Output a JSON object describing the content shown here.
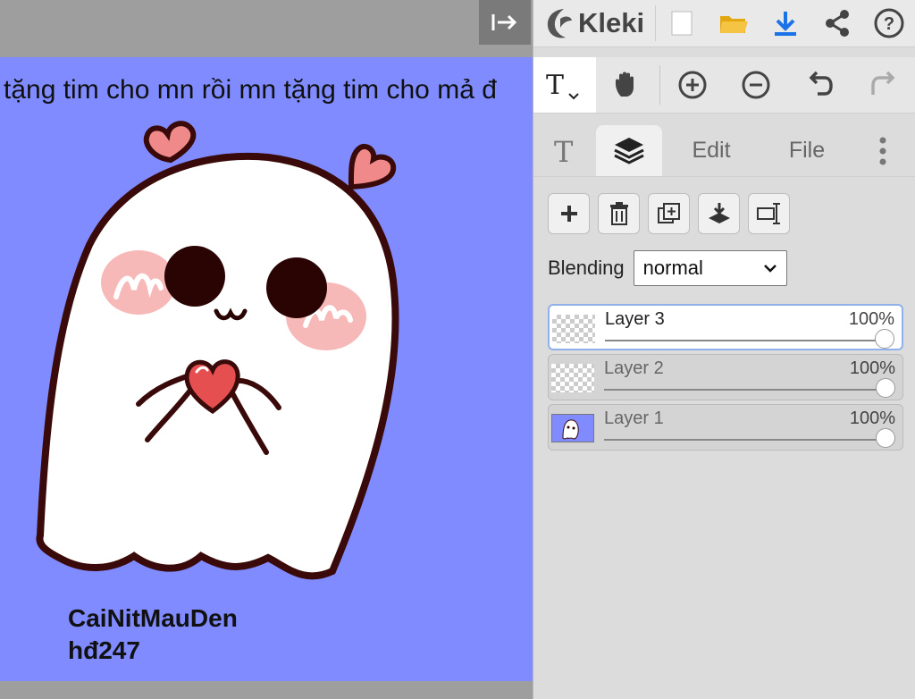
{
  "canvas": {
    "headline": "tặng tim cho mn rồi mn tặng tim cho mả đ",
    "caption_line1": "CaiNitMauDen",
    "caption_line2": "hđ247",
    "background_color": "#7f8bff"
  },
  "collapse_button": {
    "icon": "collapse-panel-icon"
  },
  "app": {
    "name": "Kleki"
  },
  "top_actions": [
    {
      "icon": "new-file-icon"
    },
    {
      "icon": "open-folder-icon"
    },
    {
      "icon": "download-icon",
      "color": "#1a73e8"
    },
    {
      "icon": "share-icon"
    },
    {
      "icon": "help-icon"
    }
  ],
  "tools": {
    "active_tool": "T",
    "items": [
      "text-tool-icon",
      "hand-tool-icon",
      "zoom-in-icon",
      "zoom-out-icon",
      "undo-icon",
      "redo-icon"
    ]
  },
  "tabs": [
    {
      "label": "T",
      "kind": "icon"
    },
    {
      "label": "layers",
      "kind": "icon",
      "active": true
    },
    {
      "label": "Edit"
    },
    {
      "label": "File"
    }
  ],
  "layer_actions": [
    "add-layer-icon",
    "delete-layer-icon",
    "duplicate-layer-icon",
    "merge-down-icon",
    "rename-layer-icon"
  ],
  "blending": {
    "label": "Blending",
    "value": "normal"
  },
  "layers": [
    {
      "name": "Layer 3",
      "opacity": "100%",
      "active": true
    },
    {
      "name": "Layer 2",
      "opacity": "100%"
    },
    {
      "name": "Layer 1",
      "opacity": "100%"
    }
  ]
}
